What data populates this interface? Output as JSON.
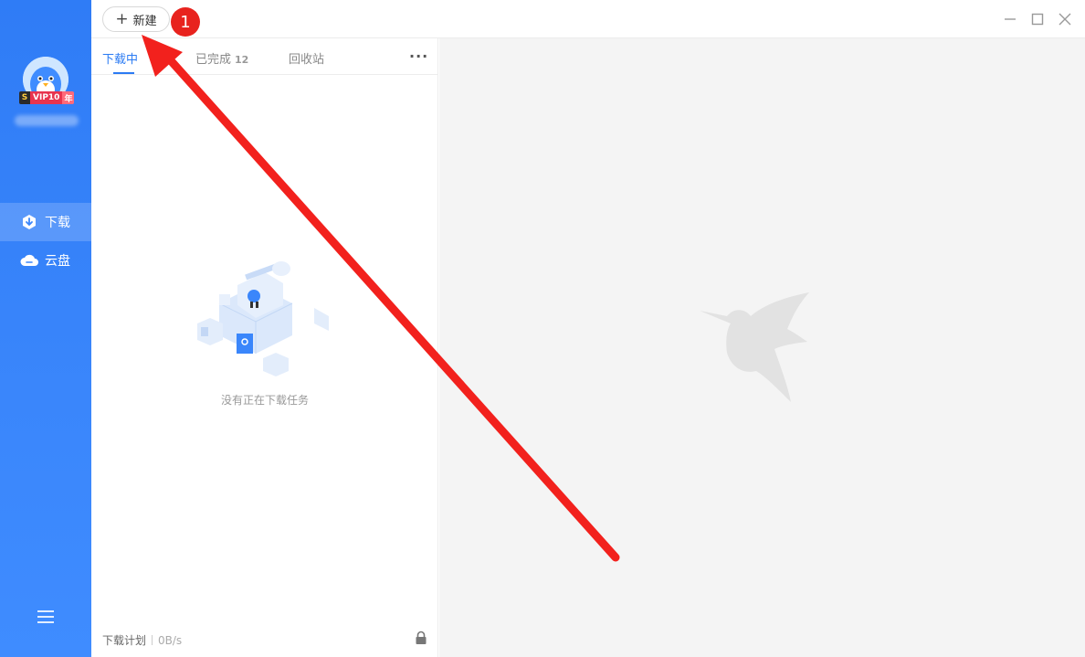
{
  "sidebar": {
    "vip": {
      "s": "S",
      "label": "VIP10",
      "year": "年"
    },
    "nav": [
      {
        "label": "下载",
        "icon": "download-icon",
        "active": true
      },
      {
        "label": "云盘",
        "icon": "cloud-icon",
        "active": false
      }
    ]
  },
  "topbar": {
    "new_label": "新建"
  },
  "tabs": {
    "downloading": "下载中",
    "completed": "已完成",
    "completed_count": "12",
    "recycle": "回收站"
  },
  "empty": {
    "text": "没有正在下载任务"
  },
  "footer": {
    "plan": "下载计划",
    "speed": "0B/s"
  },
  "annotation": {
    "step": "1",
    "color": "#e8231e"
  },
  "colors": {
    "sidebar": "#3a86fb",
    "accent": "#2b7bf3",
    "detail_bg": "#f4f4f4"
  }
}
